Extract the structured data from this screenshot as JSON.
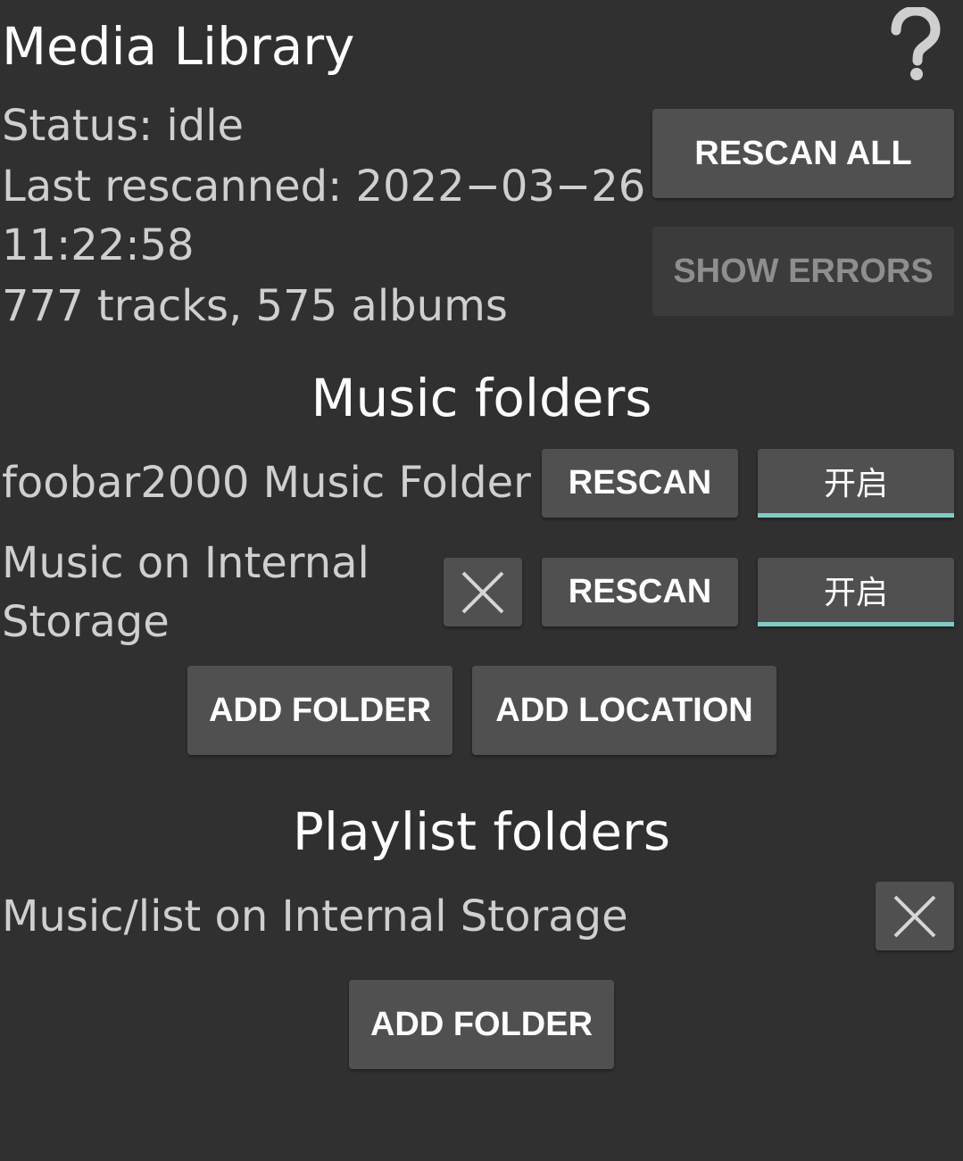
{
  "header": {
    "title": "Media Library",
    "help_icon": "question-mark-icon"
  },
  "status": {
    "status_line": "Status: idle",
    "last_rescanned_line1": "Last rescanned: 2022−03−26",
    "last_rescanned_line2": "11:22:58",
    "counts": "777 tracks, 575 albums"
  },
  "actions": {
    "rescan_all": "RESCAN ALL",
    "show_errors": "SHOW ERRORS"
  },
  "music_folders": {
    "title": "Music folders",
    "items": [
      {
        "label": "foobar2000 Music Folder",
        "rescan": "RESCAN",
        "toggle": "开启",
        "removable": false
      },
      {
        "label_line1": "Music on Internal",
        "label_line2": "Storage",
        "rescan": "RESCAN",
        "toggle": "开启",
        "removable": true
      }
    ],
    "add_folder": "ADD FOLDER",
    "add_location": "ADD LOCATION"
  },
  "playlist_folders": {
    "title": "Playlist folders",
    "items": [
      {
        "label": "Music/list on Internal Storage",
        "removable": true
      }
    ],
    "add_folder": "ADD FOLDER"
  },
  "colors": {
    "background": "#303030",
    "button": "#505050",
    "toggle_accent": "#80cbc4"
  }
}
